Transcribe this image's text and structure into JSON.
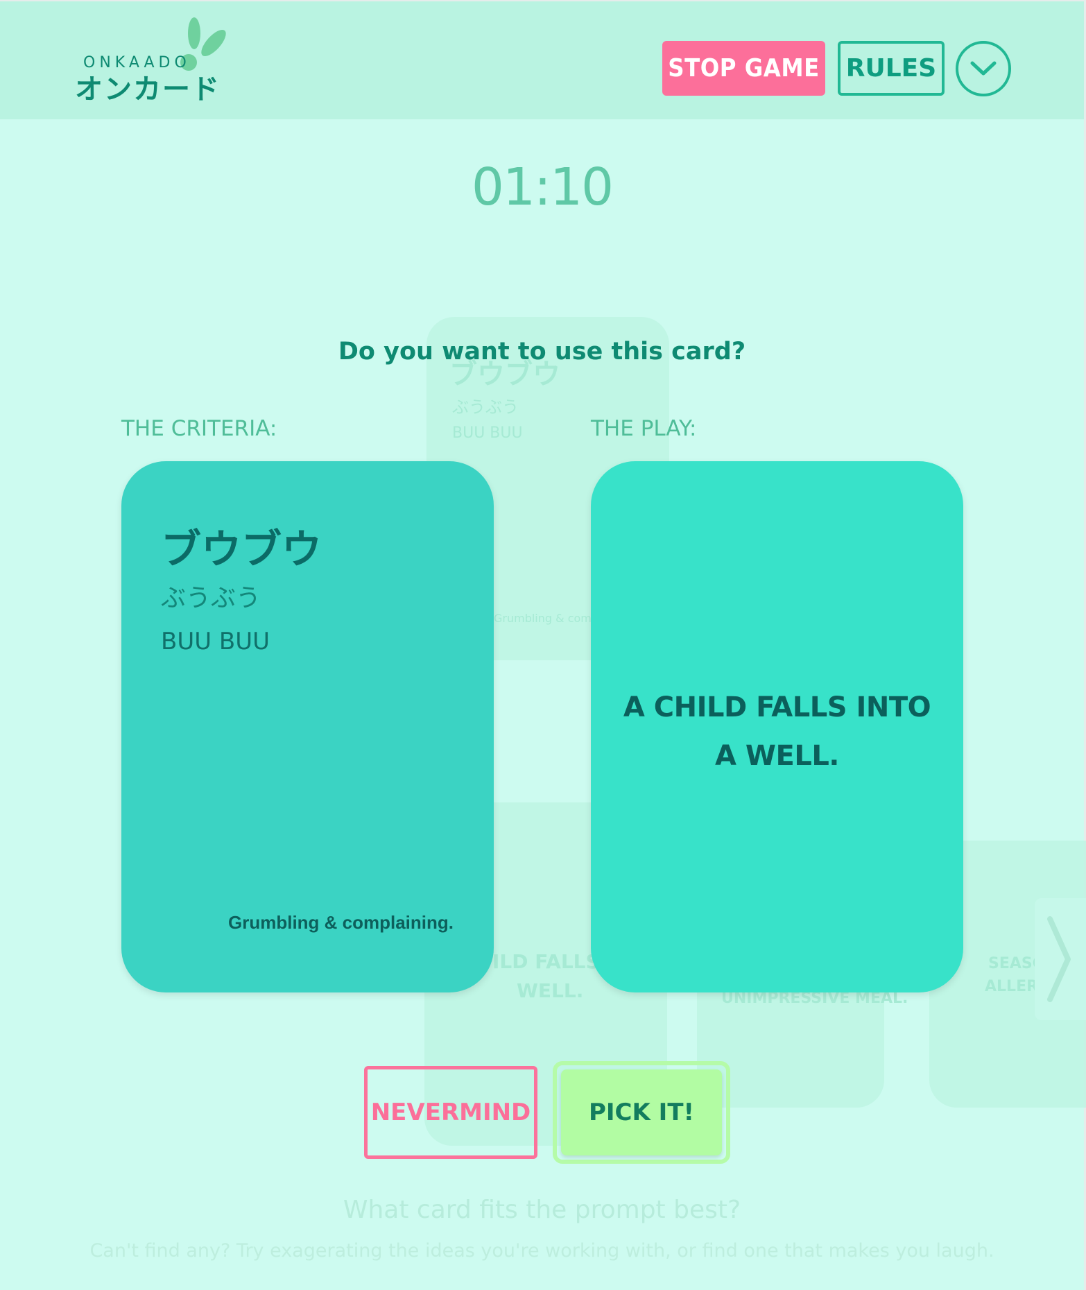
{
  "app": {
    "logo_en": "ONKAADO",
    "logo_jp": "オンカード"
  },
  "header": {
    "stop_label": "STOP GAME",
    "rules_label": "RULES"
  },
  "timer": "01:10",
  "modal": {
    "question": "Do you want to use this card?",
    "criteria_label": "THE CRITERIA:",
    "play_label": "THE PLAY:",
    "criteria_card": {
      "katakana": "ブウブウ",
      "hiragana": "ぶうぶう",
      "romaji": "BUU BUU",
      "meaning": "Grumbling & complaining."
    },
    "play_card": {
      "text": "A CHILD FALLS INTO A WELL."
    },
    "nevermind_label": "NEVERMIND",
    "pick_label": "PICK IT!"
  },
  "background": {
    "ghost_kata": "ブウブウ",
    "ghost_hira": "ぶうぶう",
    "ghost_roma": "BUU BUU",
    "ghost_meaning": "Grumbling & com",
    "ghost_play_1": "ILD FALLS IN",
    "ghost_play_2": "WELL.",
    "ghost_meal": "UNIMPRESSIVE MEAL.",
    "ghost_season_1": "SEASO",
    "ghost_season_2": "ALLERG",
    "prompt": "What card fits the prompt best?",
    "hint": "Can't find any? Try exagerating the ideas you're working with, or find one that makes you laugh."
  },
  "colors": {
    "page_bg": "#cdfbf0",
    "header_bg": "#b9f3e1",
    "accent_pink": "#fc6f9a",
    "accent_green": "#21b894",
    "criteria_card": "#3bd3c3",
    "play_card": "#38e2c9",
    "pick_button": "#b2fca3"
  },
  "icons": {
    "menu_toggle": "chevron-down-icon",
    "logo_mark": "leaf-icon",
    "next": "chevron-right-icon"
  }
}
